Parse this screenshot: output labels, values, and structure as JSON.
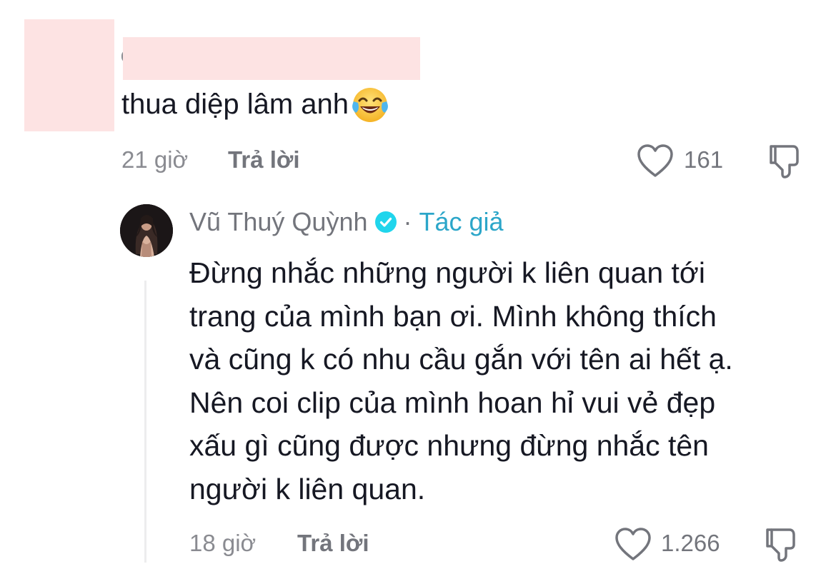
{
  "parent_comment": {
    "text": "thua diệp lâm anh",
    "emoji_icon": "face-with-tears-of-joy-emoji",
    "time": "21 giờ",
    "reply_label": "Trả lời",
    "like_count": "161"
  },
  "reply": {
    "author": "Vũ Thuý Quỳnh",
    "separator": "·",
    "author_tag": "Tác giả",
    "text_lines": [
      "Đừng nhắc những người k liên quan tới",
      "trang của mình bạn ơi. Mình không thích",
      "và cũng k có nhu cầu gắn với tên ai hết ạ.",
      "Nên coi clip của mình hoan hỉ vui vẻ đẹp",
      "xấu gì cũng được nhưng đừng nhắc tên",
      "người k liên quan."
    ],
    "time": "18 giờ",
    "reply_label": "Trả lời",
    "like_count": "1.266"
  },
  "colors": {
    "redaction": "#fde3e3",
    "verified": "#20d5ec",
    "author_tag": "#2ca6c9",
    "muted": "#73757c"
  }
}
